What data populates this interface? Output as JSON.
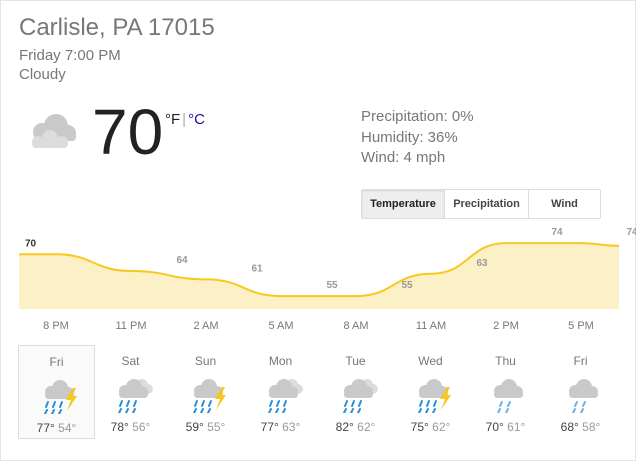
{
  "location": "Carlisle, PA 17015",
  "datetime": "Friday 7:00 PM",
  "condition": "Cloudy",
  "current": {
    "icon": "cloud-icon",
    "temperature": "70",
    "unit_f": "°F",
    "unit_sep": "|",
    "unit_c": "°C"
  },
  "details": {
    "precipitation": "Precipitation: 0%",
    "humidity": "Humidity: 36%",
    "wind": "Wind: 4 mph"
  },
  "tabs": [
    {
      "label": "Temperature",
      "active": true
    },
    {
      "label": "Precipitation",
      "active": false
    },
    {
      "label": "Wind",
      "active": false
    }
  ],
  "colors": {
    "fill": "#fcf1c6",
    "line": "#f7c81e",
    "rain": "#2d8ed6",
    "bolt": "#f7c81e",
    "cloud": "#c9c9c9"
  },
  "chart_data": {
    "type": "area",
    "categories": [
      "8 PM",
      "11 PM",
      "2 AM",
      "5 AM",
      "8 AM",
      "11 AM",
      "2 PM",
      "5 PM"
    ],
    "values": [
      70,
      64,
      61,
      55,
      55,
      63,
      74,
      74
    ],
    "ylim": [
      50,
      78
    ]
  },
  "forecast": [
    {
      "day": "Fri",
      "icon": "thunderstorm-icon",
      "high": "77°",
      "low": "54°",
      "selected": true
    },
    {
      "day": "Sat",
      "icon": "rain-icon",
      "high": "78°",
      "low": "56°",
      "selected": false
    },
    {
      "day": "Sun",
      "icon": "thunderstorm-icon",
      "high": "59°",
      "low": "55°",
      "selected": false
    },
    {
      "day": "Mon",
      "icon": "rain-icon",
      "high": "77°",
      "low": "63°",
      "selected": false
    },
    {
      "day": "Tue",
      "icon": "rain-icon",
      "high": "82°",
      "low": "62°",
      "selected": false
    },
    {
      "day": "Wed",
      "icon": "thunderstorm-icon",
      "high": "75°",
      "low": "62°",
      "selected": false
    },
    {
      "day": "Thu",
      "icon": "showers-icon",
      "high": "70°",
      "low": "61°",
      "selected": false
    },
    {
      "day": "Fri",
      "icon": "showers-icon",
      "high": "68°",
      "low": "58°",
      "selected": false
    }
  ]
}
